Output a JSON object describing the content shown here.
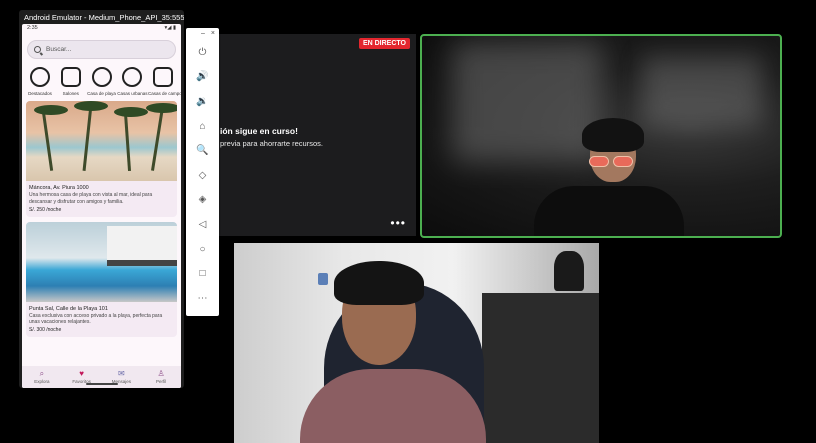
{
  "meeting": {
    "live_badge": "EN DIRECTO",
    "presenter_line1": "ión sigue en curso!",
    "presenter_line2": "previa para ahorrarte recursos.",
    "more_glyph": "•••"
  },
  "emulator": {
    "window_title": "Android Emulator - Medium_Phone_API_35:5554",
    "status_time": "2:35",
    "status_icons": "▾◢ ▮",
    "search_placeholder": "Buscar...",
    "categories": [
      {
        "label": "Destacados",
        "icon": "star-badge-icon"
      },
      {
        "label": "Salones",
        "icon": "sofa-icon"
      },
      {
        "label": "Casa de playa",
        "icon": "beach-house-icon"
      },
      {
        "label": "Casas urbanas",
        "icon": "city-house-icon"
      },
      {
        "label": "Casas de campo",
        "icon": "farm-icon"
      }
    ],
    "listings": [
      {
        "title": "Máncora, Av. Piura 1000",
        "description": "Una hermosa casa de playa con vista al mar, ideal para descansar y disfrutar con amigos y familia.",
        "price": "S/. 250 /noche"
      },
      {
        "title": "Punta Sal, Calle de la Playa 101",
        "description": "Casa exclusiva con acceso privado a la playa, perfecta para unas vacaciones relajantes.",
        "price": "S/. 300 /noche"
      }
    ],
    "bottom_nav": [
      {
        "label": "Explora",
        "icon": "⌕",
        "color": "#8e4f8a"
      },
      {
        "label": "Favoritos",
        "icon": "♥",
        "color": "#c2185b"
      },
      {
        "label": "Mensajes",
        "icon": "✉",
        "color": "#6a6aa8"
      },
      {
        "label": "Perfil",
        "icon": "♙",
        "color": "#8e4f8a"
      }
    ],
    "toolbar": {
      "minimize": "–",
      "close": "×",
      "buttons": [
        "⏻",
        "🔊",
        "🔉",
        "⌂",
        "🔍",
        "◇",
        "◈",
        "◁",
        "○",
        "□",
        "⋯"
      ]
    }
  }
}
